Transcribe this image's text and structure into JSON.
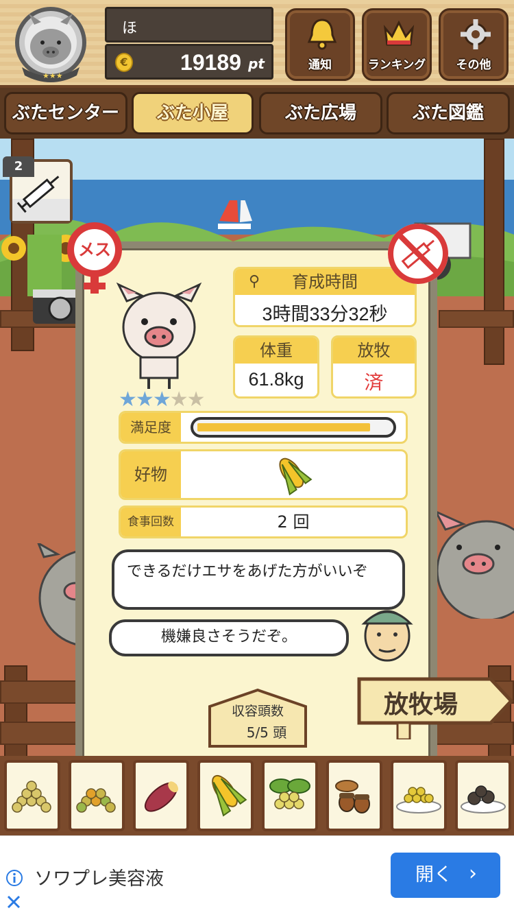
{
  "header": {
    "player_name": "ほ",
    "coin_symbol": "€",
    "points": "19189",
    "points_unit": "pt",
    "buttons": [
      {
        "label": "通知",
        "icon": "bell-icon"
      },
      {
        "label": "ランキング",
        "icon": "crown-icon"
      },
      {
        "label": "その他",
        "icon": "gear-icon"
      }
    ]
  },
  "nav": {
    "tabs": [
      {
        "label": "ぶたセンター",
        "active": false
      },
      {
        "label": "ぶた小屋",
        "active": true
      },
      {
        "label": "ぶた広場",
        "active": false
      },
      {
        "label": "ぶた図鑑",
        "active": false
      }
    ]
  },
  "injection": {
    "count": "2"
  },
  "pig_card": {
    "gender_label": "メス",
    "stars_filled": 3,
    "stars_total": 5,
    "growth_time_label": "育成時間",
    "growth_time_value": "3時間33分32秒",
    "weight_label": "体重",
    "weight_value": "61.8kg",
    "grazing_label": "放牧",
    "grazing_value": "済",
    "satisfaction_label": "満足度",
    "satisfaction_level": 0.9,
    "favorite_label": "好物",
    "favorite_icon": "corn-icon",
    "meals_label": "食事回数",
    "meals_value": "2 回",
    "speech_1": "できるだけエサをあげた方がいいぞ",
    "speech_2": "機嫌良さそうだぞ。"
  },
  "capacity": {
    "label": "収容頭数",
    "value": "5/5 頭"
  },
  "grazing_sign": "放牧場",
  "foods": [
    "soybean-icon",
    "mixed-beans-icon",
    "sweet-potato-icon",
    "corn-icon",
    "herb-beans-icon",
    "acorn-icon",
    "grain-dish-icon",
    "dark-balls-dish-icon"
  ],
  "ad": {
    "text": "ソワプレ美容液",
    "button_label": "開く",
    "info_icon": "info-icon",
    "close_icon": "close-icon"
  }
}
